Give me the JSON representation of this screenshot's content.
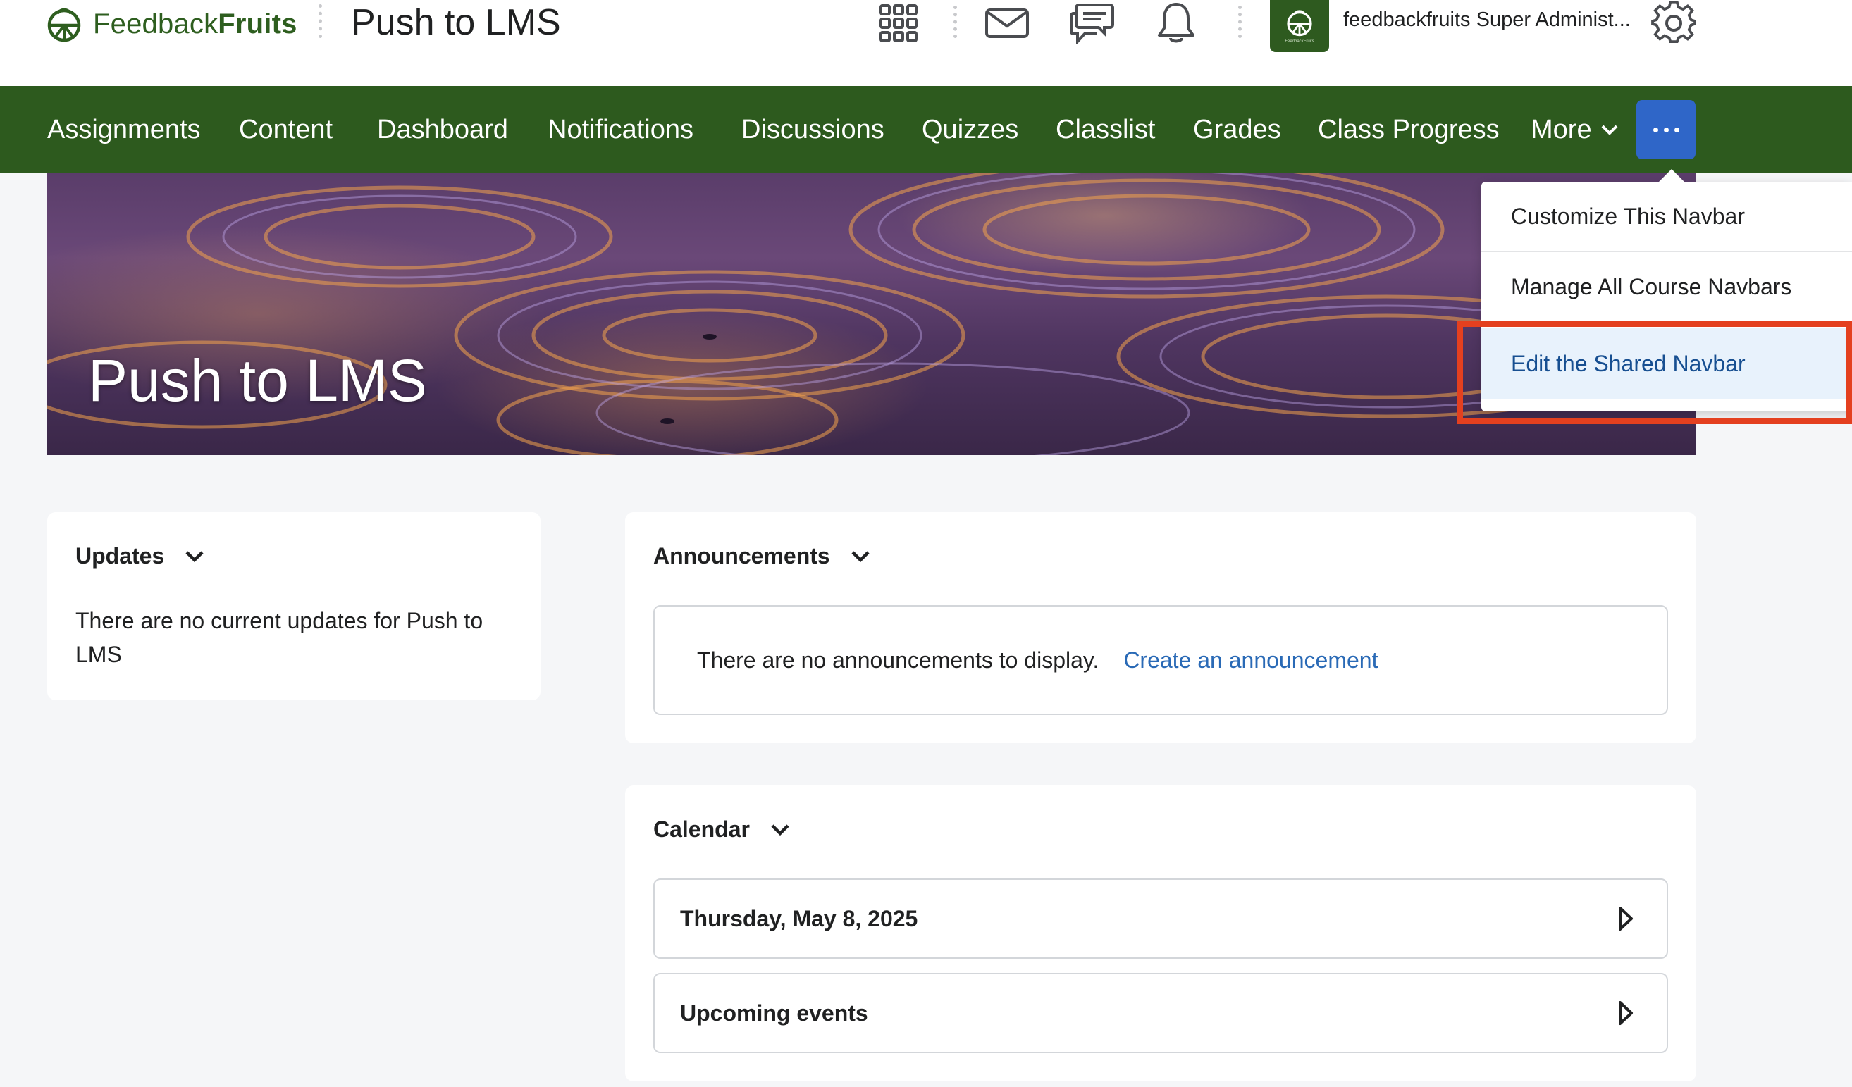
{
  "header": {
    "logo_text_regular": "Feedback",
    "logo_text_bold": "Fruits",
    "course_title": "Push to LMS",
    "icons": [
      "apps-grid-icon",
      "mail-icon",
      "chat-icon",
      "bell-icon",
      "org-logo-icon",
      "gear-icon"
    ],
    "user_name": "feedbackfruits Super Administ..."
  },
  "navbar": {
    "items": [
      {
        "label": "Assignments"
      },
      {
        "label": "Content"
      },
      {
        "label": "Dashboard"
      },
      {
        "label": "Notifications"
      },
      {
        "label": "Discussions"
      },
      {
        "label": "Quizzes"
      },
      {
        "label": "Classlist"
      },
      {
        "label": "Grades"
      },
      {
        "label": "Class Progress"
      }
    ],
    "more_label": "More",
    "accent_color": "#2d5a1e",
    "active_button_color": "#2f66c8"
  },
  "banner": {
    "title": "Push to LMS"
  },
  "dropdown": {
    "items": [
      {
        "label": "Customize This Navbar"
      },
      {
        "label": "Manage All Course Navbars"
      },
      {
        "label": "Edit the Shared Navbar",
        "selected": true
      }
    ],
    "highlight_color": "#e4401f"
  },
  "updates": {
    "title": "Updates",
    "message": "There are no current updates for Push to LMS"
  },
  "announcements": {
    "title": "Announcements",
    "message": "There are no announcements to display.",
    "link": "Create an announcement"
  },
  "calendar": {
    "title": "Calendar",
    "rows": [
      {
        "label": "Thursday, May 8, 2025"
      },
      {
        "label": "Upcoming events"
      }
    ]
  }
}
